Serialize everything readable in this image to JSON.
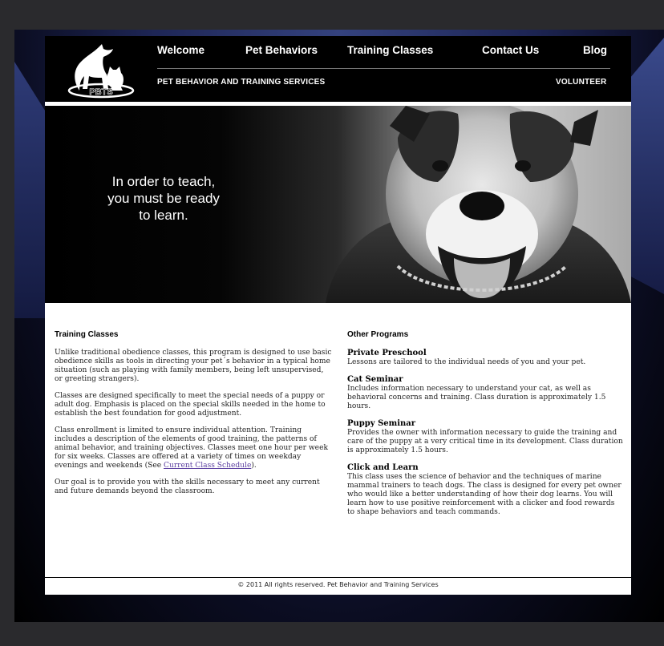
{
  "site": {
    "logo_icon": "dog-cat-logo-icon",
    "logo_text": "PBTS"
  },
  "nav": {
    "primary": [
      {
        "label": "Welcome"
      },
      {
        "label": "Pet Behaviors"
      },
      {
        "label": "Training Classes"
      },
      {
        "label": "Contact Us"
      },
      {
        "label": "Blog"
      }
    ],
    "tagline": "PET BEHAVIOR AND TRAINING SERVICES",
    "secondary": "VOLUNTEER"
  },
  "hero": {
    "quote_lines": [
      "In order to teach,",
      "you must be ready",
      "to learn."
    ]
  },
  "training": {
    "title": "Training Classes",
    "p1": "Unlike traditional obedience classes, this program is designed to use basic obedience skills as tools in directing your pet´s behavior in a typical home situation (such as playing with family members, being left unsupervised, or greeting strangers).",
    "p2": "Classes are designed specifically to meet the special needs of a puppy or adult dog. Emphasis is placed on the special skills needed in the home to establish the best foundation for good adjustment.",
    "p3_before": "Class enrollment is limited to ensure individual attention. Training includes a description of the elements of good training, the patterns of animal behavior, and training objectives. Classes meet one hour per week for six weeks. Classes are offered at a variety of times on weekday evenings and weekends (See ",
    "p3_link": "Current Class Schedule",
    "p3_after": ").",
    "p4": "Our goal is to provide you with the skills necessary to meet any current and future demands beyond the classroom."
  },
  "programs": {
    "title": "Other Programs",
    "items": [
      {
        "title": "Private Preschool",
        "desc": "Lessons are tailored to the individual needs of you and your pet."
      },
      {
        "title": "Cat Seminar",
        "desc": "Includes information necessary to understand your cat, as well as behavioral concerns and training. Class duration is approximately 1.5 hours."
      },
      {
        "title": "Puppy Seminar",
        "desc": "Provides the owner with information necessary to guide the training and care of the puppy at a very critical time in its development. Class duration is approximately 1.5 hours."
      },
      {
        "title": "Click and Learn",
        "desc": "This class uses the science of behavior and the techniques of marine mammal trainers to teach dogs. The class is designed for every pet owner who would like a better understanding of how their dog learns. You will learn how to use positive reinforcement with a clicker and food rewards to shape behaviors and teach commands."
      }
    ]
  },
  "footer": {
    "text": "© 2011 All rights reserved. Pet Behavior and Training Services"
  }
}
